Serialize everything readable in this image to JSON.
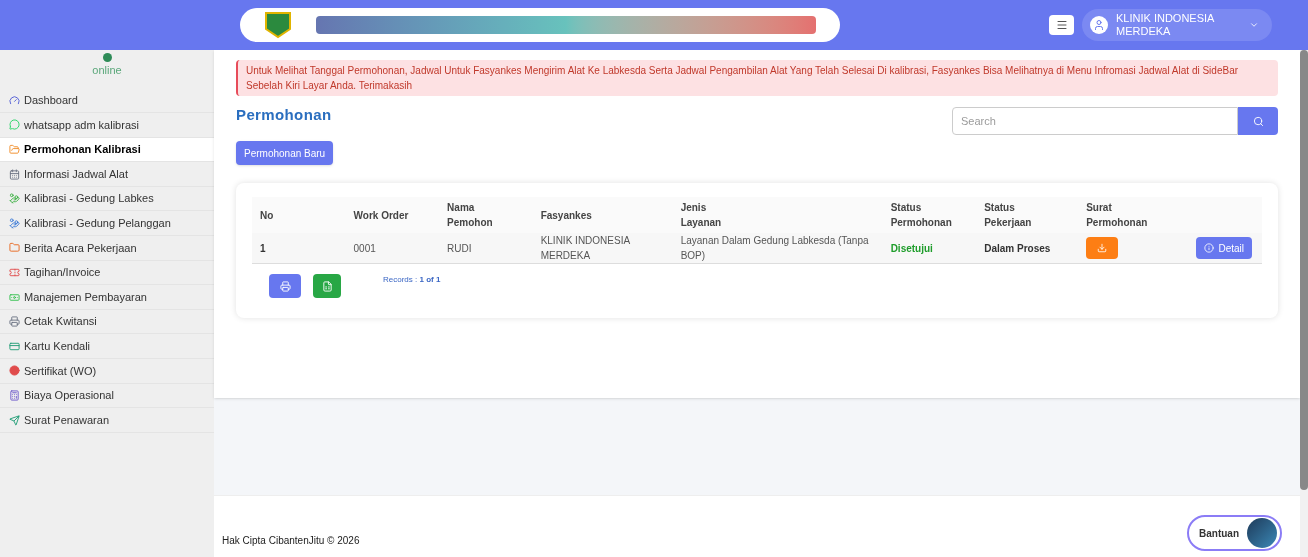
{
  "header": {
    "user": {
      "name": "KLINIK INDONESIA MERDEKA"
    }
  },
  "sidebar": {
    "status": "online",
    "items": [
      {
        "label": "Dashboard",
        "selected": false
      },
      {
        "label": "whatsapp adm kalibrasi",
        "selected": false
      },
      {
        "label": "Permohonan Kalibrasi",
        "selected": true
      },
      {
        "label": "Informasi Jadwal Alat",
        "selected": false
      },
      {
        "label": "Kalibrasi - Gedung Labkes",
        "selected": false
      },
      {
        "label": "Kalibrasi - Gedung Pelanggan",
        "selected": false
      },
      {
        "label": "Berita Acara Pekerjaan",
        "selected": false
      },
      {
        "label": "Tagihan/Invoice",
        "selected": false
      },
      {
        "label": "Manajemen Pembayaran",
        "selected": false
      },
      {
        "label": "Cetak Kwitansi",
        "selected": false
      },
      {
        "label": "Kartu Kendali",
        "selected": false
      },
      {
        "label": "Sertifikat (WO)",
        "selected": false
      },
      {
        "label": "Biaya Operasional",
        "selected": false
      },
      {
        "label": "Surat Penawaran",
        "selected": false
      }
    ]
  },
  "alert": "Untuk Melihat Tanggal Permohonan, Jadwal Untuk Fasyankes Mengirim Alat Ke Labkesda Serta Jadwal Pengambilan Alat Yang Telah Selesai Di kalibrasi, Fasyankes Bisa Melihatnya di Menu Infromasi Jadwal Alat di SideBar Sebelah Kiri Layar Anda. Terimakasih",
  "page_title": "Permohonan",
  "search": {
    "placeholder": "Search"
  },
  "new_button": "Permohonan Baru",
  "table": {
    "columns": [
      "No",
      "Work Order",
      "Nama Pemohon",
      "Fasyankes",
      "Jenis Layanan",
      "Status Permohonan",
      "Status Pekerjaan",
      "Surat Permohonan"
    ],
    "rows": [
      {
        "no": "1",
        "work_order": "0001",
        "nama": "RUDI",
        "fasyankes": "KLINIK INDONESIA MERDEKA",
        "layanan": "Layanan Dalam Gedung Labkesda (Tanpa BOP)",
        "status_permohonan": "Disetujui",
        "status_pekerjaan": "Dalam Proses",
        "action": "Detail"
      }
    ]
  },
  "records": {
    "label": "Records :",
    "value": "1 of 1"
  },
  "footer": {
    "copyright": "Hak Cipta CibantenJitu © 2026",
    "help_button": "Bantuan"
  }
}
